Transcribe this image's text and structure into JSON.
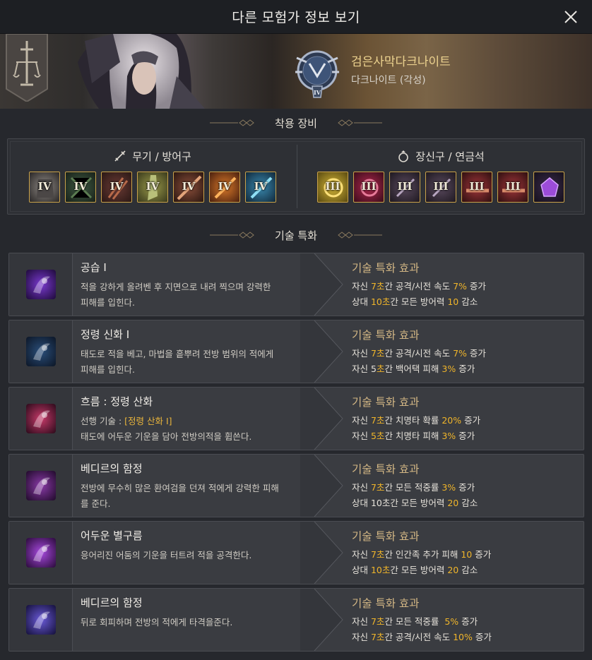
{
  "window": {
    "title": "다른 모험가 정보 보기"
  },
  "character": {
    "name": "검은사막다크나이트",
    "class_label": "다크나이트 (각성)",
    "emblem_tier": "IV"
  },
  "equipment": {
    "section_title": "착용 장비",
    "weapons": {
      "title": "무기 / 방어구",
      "items": [
        {
          "tier": "IV",
          "icon": "armor-icon"
        },
        {
          "tier": "IV",
          "icon": "gloves-icon"
        },
        {
          "tier": "IV",
          "icon": "claw-gauntlet-icon"
        },
        {
          "tier": "IV",
          "icon": "boots-icon"
        },
        {
          "tier": "IV",
          "icon": "kriegsmesser-icon"
        },
        {
          "tier": "IV",
          "icon": "vediant-icon"
        },
        {
          "tier": "IV",
          "icon": "awakening-weapon-icon"
        }
      ]
    },
    "accessories": {
      "title": "장신구 / 연금석",
      "items": [
        {
          "tier": "III",
          "icon": "necklace-icon"
        },
        {
          "tier": "III",
          "icon": "ring-icon"
        },
        {
          "tier": "III",
          "icon": "earring-icon"
        },
        {
          "tier": "III",
          "icon": "earring-icon"
        },
        {
          "tier": "III",
          "icon": "belt-icon"
        },
        {
          "tier": "III",
          "icon": "belt-icon"
        },
        {
          "tier": "",
          "icon": "alchemy-stone-icon"
        }
      ]
    }
  },
  "skills": {
    "section_title": "기술 특화",
    "effect_header": "기술 특화 효과",
    "items": [
      {
        "name": "공습 I",
        "prereq_label": "",
        "prereq_value": "",
        "desc": [
          "적을 강하게 올려벤 후 지면으로 내려 찍으며 강력한",
          "피해를 입힌다."
        ],
        "icon": "assault-skill-icon",
        "effects": [
          [
            {
              "t": "자신 "
            },
            {
              "t": "7초",
              "h": true
            },
            {
              "t": "간 공격/시전 속도 "
            },
            {
              "t": "7%",
              "h": true
            },
            {
              "t": " 증가"
            }
          ],
          [
            {
              "t": "상대 "
            },
            {
              "t": "10초",
              "h": true
            },
            {
              "t": "간 모든 방어력 "
            },
            {
              "t": "10",
              "h": true
            },
            {
              "t": " 감소"
            }
          ]
        ]
      },
      {
        "name": "정령 신화 I",
        "prereq_label": "",
        "prereq_value": "",
        "desc": [
          "태도로 적을 베고, 마법을 흩뿌려 전방 범위의 적에게",
          "피해를 입힌다."
        ],
        "icon": "spirit-skill-icon",
        "effects": [
          [
            {
              "t": "자신 "
            },
            {
              "t": "7초",
              "h": true
            },
            {
              "t": "간 공격/시전 속도 "
            },
            {
              "t": "7%",
              "h": true
            },
            {
              "t": " 증가"
            }
          ],
          [
            {
              "t": "자신 5"
            },
            {
              "t": "초",
              "h": true
            },
            {
              "t": "간 백어택 피해 "
            },
            {
              "t": "3%",
              "h": true
            },
            {
              "t": " 증가"
            }
          ]
        ]
      },
      {
        "name": "흐름 : 정령 산화",
        "prereq_label": "선행 기술 : ",
        "prereq_value": "[정령 산화 I]",
        "desc": [
          "태도에 어두운 기운을 담아 전방의적을 휩쓴다."
        ],
        "icon": "flow-skill-icon",
        "effects": [
          [
            {
              "t": "자신 "
            },
            {
              "t": "7초",
              "h": true
            },
            {
              "t": "간 치명타 확률 "
            },
            {
              "t": "20%",
              "h": true
            },
            {
              "t": " 증가"
            }
          ],
          [
            {
              "t": "자신 "
            },
            {
              "t": "5초",
              "h": true
            },
            {
              "t": "간 치명타 피해 "
            },
            {
              "t": "3%",
              "h": true
            },
            {
              "t": " 증가"
            }
          ]
        ]
      },
      {
        "name": "베디르의 함정",
        "prereq_label": "",
        "prereq_value": "",
        "desc": [
          "전방에 무수히 많은 환여검을 던져 적에게 강력한 피해",
          "를 준다."
        ],
        "icon": "vedir-trap-skill-icon",
        "effects": [
          [
            {
              "t": "자신 "
            },
            {
              "t": "7초",
              "h": true
            },
            {
              "t": "간 모든 적중률 "
            },
            {
              "t": "3%",
              "h": true
            },
            {
              "t": " 증가"
            }
          ],
          [
            {
              "t": "상대 10초간 모든 방어력 "
            },
            {
              "t": "20",
              "h": true
            },
            {
              "t": " 감소"
            }
          ]
        ]
      },
      {
        "name": "어두운 별구름",
        "prereq_label": "",
        "prereq_value": "",
        "desc": [
          "응어리진 어둠의 기운을 터트려 적을 공격한다."
        ],
        "icon": "dark-nebula-skill-icon",
        "effects": [
          [
            {
              "t": "자신 "
            },
            {
              "t": "7초",
              "h": true
            },
            {
              "t": "간 인간족 추가 피해 "
            },
            {
              "t": "10",
              "h": true
            },
            {
              "t": " 증가"
            }
          ],
          [
            {
              "t": "상대 "
            },
            {
              "t": "10초",
              "h": true
            },
            {
              "t": "간 모든 방어력 "
            },
            {
              "t": "20",
              "h": true
            },
            {
              "t": " 감소"
            }
          ]
        ]
      },
      {
        "name": "베디르의 함정",
        "prereq_label": "",
        "prereq_value": "",
        "desc": [
          "뒤로 회피하며 전방의 적에게 타격을준다."
        ],
        "icon": "evasion-strike-skill-icon",
        "effects": [
          [
            {
              "t": "자신 "
            },
            {
              "t": "7초",
              "h": true
            },
            {
              "t": "간 모든 적중률  "
            },
            {
              "t": "5%",
              "h": true
            },
            {
              "t": " 증가"
            }
          ],
          [
            {
              "t": "자신 "
            },
            {
              "t": "7초",
              "h": true
            },
            {
              "t": "간 공격/시전 속도 "
            },
            {
              "t": "10%",
              "h": true
            },
            {
              "t": " 증가"
            }
          ]
        ]
      }
    ]
  },
  "colors": {
    "background": "#26282d",
    "highlight": "#f0b52a",
    "gold_border": "#c9a24a",
    "effect_header": "#d2b684",
    "prereq": "#e8b43c"
  }
}
